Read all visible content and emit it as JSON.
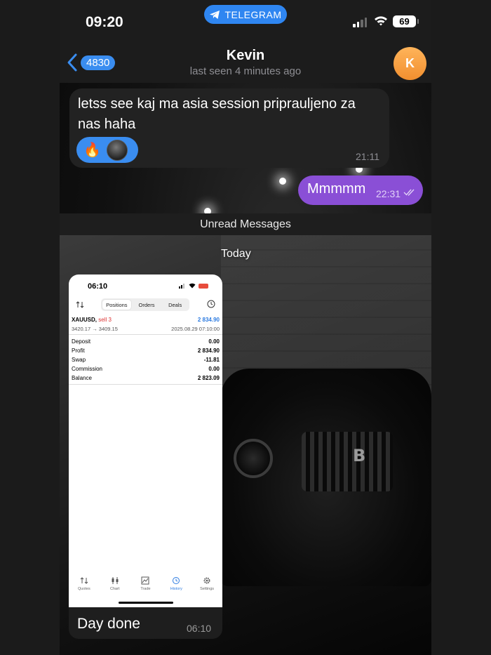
{
  "status_bar": {
    "time": "09:20",
    "app_pill": "TELEGRAM",
    "battery": "69"
  },
  "header": {
    "back_count": "4830",
    "name": "Kevin",
    "last_seen": "last seen 4 minutes ago",
    "avatar_letter": "K"
  },
  "messages": [
    {
      "text": "letss see kaj ma asia session priprauljeno za nas haha",
      "reaction": "🔥",
      "time": "21:11"
    },
    {
      "text": "Mmmmm",
      "time": "22:31"
    }
  ],
  "unread_label": "Unread Messages",
  "date_label": "Today",
  "image_message": {
    "caption": "Day done",
    "time": "06:10",
    "screenshot": {
      "time": "06:10",
      "tabs": [
        "Positions",
        "Orders",
        "Deals"
      ],
      "symbol": "XAUUSD",
      "side": "sell 3",
      "profit_value": "2 834.90",
      "price_line": "3420.17 → 3409.15",
      "date": "2025.08.29 07:10:00",
      "summary": [
        {
          "label": "Deposit",
          "value": "0.00"
        },
        {
          "label": "Profit",
          "value": "2 834.90"
        },
        {
          "label": "Swap",
          "value": "-11.81"
        },
        {
          "label": "Commission",
          "value": "0.00"
        },
        {
          "label": "Balance",
          "value": "2 823.09"
        }
      ],
      "bottom_tabs": [
        "Quotes",
        "Chart",
        "Trade",
        "History",
        "Settings"
      ]
    }
  },
  "colors": {
    "accent_blue": "#3a8df0",
    "outgoing_bubble": "#8a4fd6",
    "avatar": "#f5a449"
  }
}
